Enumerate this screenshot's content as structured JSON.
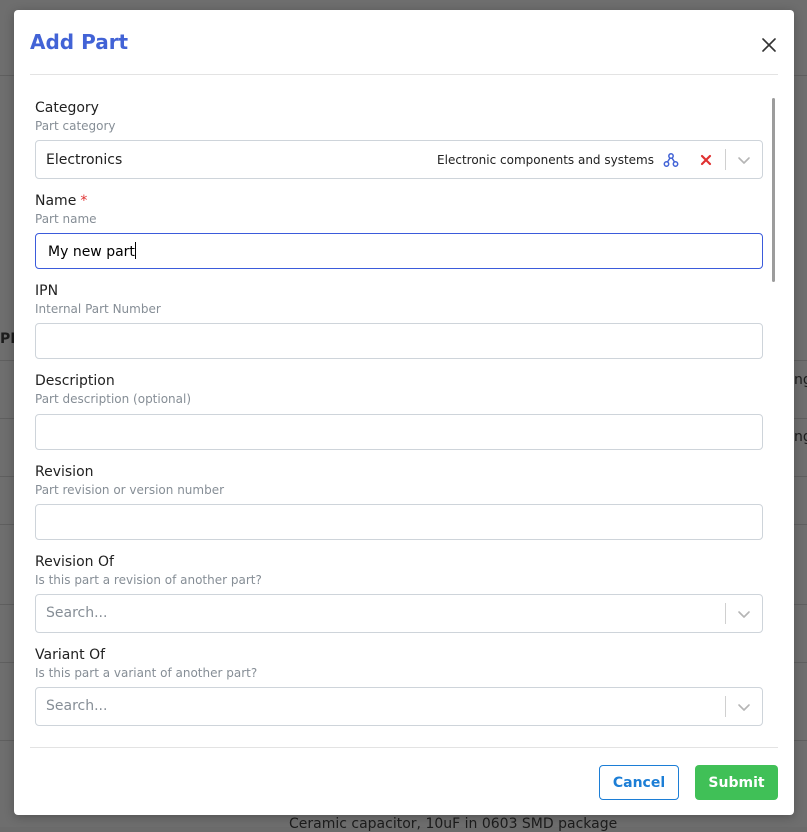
{
  "background": {
    "fragments": [
      "PN",
      "ng",
      "ng",
      "Ceramic capacitor, 10uF in 0603 SMD package"
    ]
  },
  "modal": {
    "title": "Add Part",
    "close_icon": "close-icon",
    "fields": {
      "category": {
        "label": "Category",
        "description": "Part category",
        "value": "Electronics",
        "hint": "Electronic components and systems",
        "tree_icon": "sitemap-icon",
        "clear_icon": "clear-icon",
        "dropdown_icon": "chevron-down-icon"
      },
      "name": {
        "label": "Name",
        "required_mark": "*",
        "description": "Part name",
        "value": "My new part"
      },
      "ipn": {
        "label": "IPN",
        "description": "Internal Part Number",
        "value": ""
      },
      "description": {
        "label": "Description",
        "description": "Part description (optional)",
        "value": ""
      },
      "revision": {
        "label": "Revision",
        "description": "Part revision or version number",
        "value": ""
      },
      "revision_of": {
        "label": "Revision Of",
        "description": "Is this part a revision of another part?",
        "placeholder": "Search...",
        "dropdown_icon": "chevron-down-icon"
      },
      "variant_of": {
        "label": "Variant Of",
        "description": "Is this part a variant of another part?",
        "placeholder": "Search...",
        "dropdown_icon": "chevron-down-icon"
      }
    },
    "buttons": {
      "cancel": "Cancel",
      "submit": "Submit"
    },
    "colors": {
      "title": "#4263d6",
      "submit": "#40c057",
      "cancel": "#1c7ed6",
      "focus": "#3b5bdb",
      "required": "#e03131",
      "clear": "#e03131"
    }
  }
}
